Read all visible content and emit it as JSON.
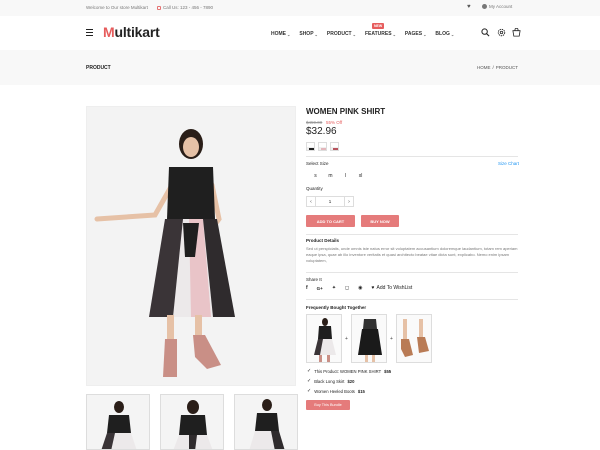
{
  "topbar": {
    "welcome": "Welcome to Our store Multikart",
    "call": "Call Us: 123 - 456 - 7890",
    "account": "My Account"
  },
  "header": {
    "logo_first": "M",
    "logo_rest": "ultikart",
    "nav": [
      {
        "label": "HOME"
      },
      {
        "label": "SHOP"
      },
      {
        "label": "PRODUCT"
      },
      {
        "label": "FEATURES"
      },
      {
        "label": "PAGES"
      },
      {
        "label": "BLOG"
      }
    ],
    "new_badge": "NEW"
  },
  "breadcrumb": {
    "title": "PRODUCT",
    "home": "HOME",
    "sep": "/",
    "current": "PRODUCT"
  },
  "product": {
    "name": "WOMEN PINK SHIRT",
    "old_price": "$459.00",
    "discount": "55% Off",
    "price": "$32.96",
    "select_size_label": "Select Size",
    "size_chart": "Size Chart",
    "sizes": [
      "s",
      "m",
      "l",
      "xl"
    ],
    "quantity_label": "Quantity",
    "quantity": "1",
    "add_to_cart": "ADD TO CART",
    "buy_now": "BUY NOW",
    "details_title": "Product Details",
    "details_text": "Sed ut perspiciatis, unde omnis iste natus error sit voluptatem accusantium doloremque laudantium, totam rem aperiam eaque ipsa, quae ab illo inventore veritatis et quasi architecto beatae vitae dicta sunt, explicabo. Nemo enim ipsam voluptatem,",
    "share_label": "Share It",
    "wishlist": "Add To WishList"
  },
  "bundle": {
    "title": "Frequently Bought Together",
    "items": [
      {
        "name": "This Product: WOMEN PINK SHIRT",
        "price": "$55"
      },
      {
        "name": "Black Long Skirt",
        "price": "$20"
      },
      {
        "name": "Women Heeled Boots",
        "price": "$15"
      }
    ],
    "button": "Buy This Bundle"
  },
  "colors": {
    "accent": "#e65c5c",
    "button": "#e57b7b",
    "link": "#2196f3"
  }
}
